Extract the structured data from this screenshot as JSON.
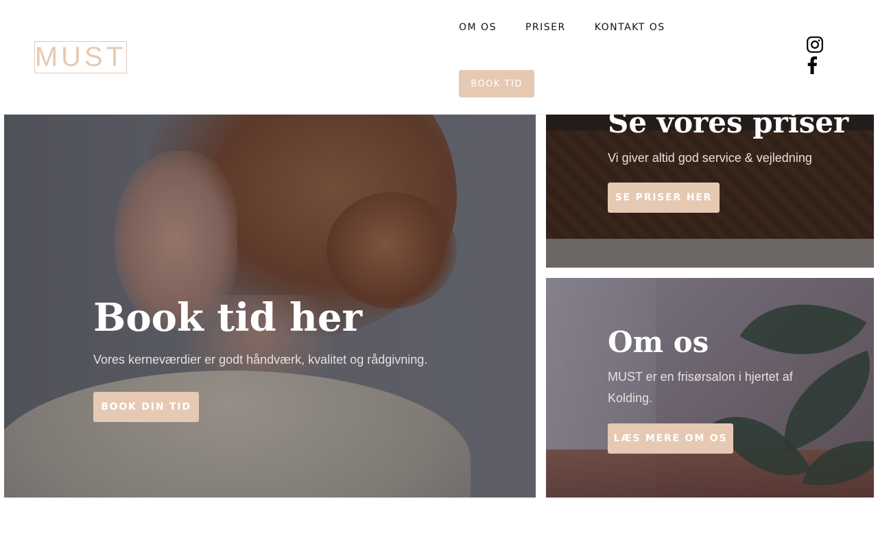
{
  "header": {
    "logo_text": "MUST",
    "nav": [
      {
        "label": "OM OS"
      },
      {
        "label": "PRISER"
      },
      {
        "label": "KONTAKT OS"
      }
    ],
    "book_button": "BOOK TID",
    "social": [
      "instagram-icon",
      "facebook-icon"
    ]
  },
  "hero": {
    "title": "Book tid her",
    "subtitle": "Vores kerneværdier er godt håndværk, kvalitet og rådgivning.",
    "button": "BOOK DIN TID"
  },
  "prices_card": {
    "title": "Se vores priser",
    "subtitle": "Vi giver altid god service & vejledning",
    "button": "SE PRISER HER"
  },
  "about_card": {
    "title": "Om os",
    "subtitle": "MUST er en frisørsalon i hjertet af Kolding.",
    "button": "LÆS MERE OM OS"
  },
  "colors": {
    "accent": "#e6c9b3",
    "text_dark": "#111111",
    "white": "#ffffff"
  }
}
